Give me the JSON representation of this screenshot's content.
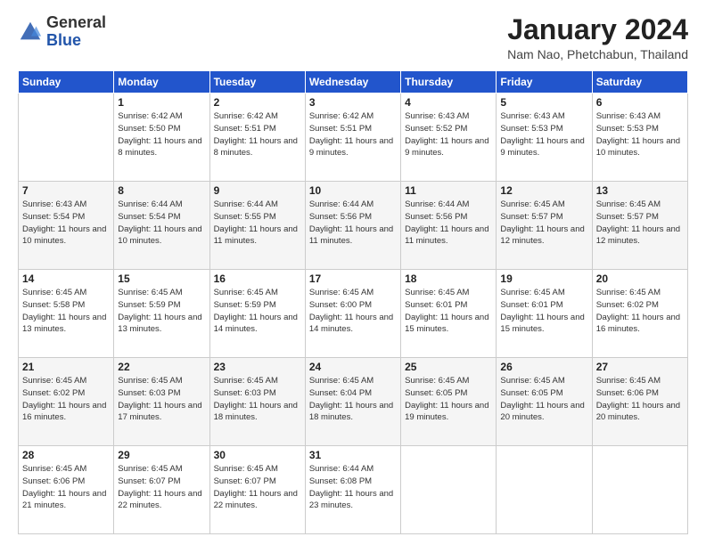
{
  "header": {
    "logo_general": "General",
    "logo_blue": "Blue",
    "title": "January 2024",
    "location": "Nam Nao, Phetchabun, Thailand"
  },
  "days_of_week": [
    "Sunday",
    "Monday",
    "Tuesday",
    "Wednesday",
    "Thursday",
    "Friday",
    "Saturday"
  ],
  "weeks": [
    [
      {
        "day": "",
        "sunrise": "",
        "sunset": "",
        "daylight": ""
      },
      {
        "day": "1",
        "sunrise": "Sunrise: 6:42 AM",
        "sunset": "Sunset: 5:50 PM",
        "daylight": "Daylight: 11 hours and 8 minutes."
      },
      {
        "day": "2",
        "sunrise": "Sunrise: 6:42 AM",
        "sunset": "Sunset: 5:51 PM",
        "daylight": "Daylight: 11 hours and 8 minutes."
      },
      {
        "day": "3",
        "sunrise": "Sunrise: 6:42 AM",
        "sunset": "Sunset: 5:51 PM",
        "daylight": "Daylight: 11 hours and 9 minutes."
      },
      {
        "day": "4",
        "sunrise": "Sunrise: 6:43 AM",
        "sunset": "Sunset: 5:52 PM",
        "daylight": "Daylight: 11 hours and 9 minutes."
      },
      {
        "day": "5",
        "sunrise": "Sunrise: 6:43 AM",
        "sunset": "Sunset: 5:53 PM",
        "daylight": "Daylight: 11 hours and 9 minutes."
      },
      {
        "day": "6",
        "sunrise": "Sunrise: 6:43 AM",
        "sunset": "Sunset: 5:53 PM",
        "daylight": "Daylight: 11 hours and 10 minutes."
      }
    ],
    [
      {
        "day": "7",
        "sunrise": "Sunrise: 6:43 AM",
        "sunset": "Sunset: 5:54 PM",
        "daylight": "Daylight: 11 hours and 10 minutes."
      },
      {
        "day": "8",
        "sunrise": "Sunrise: 6:44 AM",
        "sunset": "Sunset: 5:54 PM",
        "daylight": "Daylight: 11 hours and 10 minutes."
      },
      {
        "day": "9",
        "sunrise": "Sunrise: 6:44 AM",
        "sunset": "Sunset: 5:55 PM",
        "daylight": "Daylight: 11 hours and 11 minutes."
      },
      {
        "day": "10",
        "sunrise": "Sunrise: 6:44 AM",
        "sunset": "Sunset: 5:56 PM",
        "daylight": "Daylight: 11 hours and 11 minutes."
      },
      {
        "day": "11",
        "sunrise": "Sunrise: 6:44 AM",
        "sunset": "Sunset: 5:56 PM",
        "daylight": "Daylight: 11 hours and 11 minutes."
      },
      {
        "day": "12",
        "sunrise": "Sunrise: 6:45 AM",
        "sunset": "Sunset: 5:57 PM",
        "daylight": "Daylight: 11 hours and 12 minutes."
      },
      {
        "day": "13",
        "sunrise": "Sunrise: 6:45 AM",
        "sunset": "Sunset: 5:57 PM",
        "daylight": "Daylight: 11 hours and 12 minutes."
      }
    ],
    [
      {
        "day": "14",
        "sunrise": "Sunrise: 6:45 AM",
        "sunset": "Sunset: 5:58 PM",
        "daylight": "Daylight: 11 hours and 13 minutes."
      },
      {
        "day": "15",
        "sunrise": "Sunrise: 6:45 AM",
        "sunset": "Sunset: 5:59 PM",
        "daylight": "Daylight: 11 hours and 13 minutes."
      },
      {
        "day": "16",
        "sunrise": "Sunrise: 6:45 AM",
        "sunset": "Sunset: 5:59 PM",
        "daylight": "Daylight: 11 hours and 14 minutes."
      },
      {
        "day": "17",
        "sunrise": "Sunrise: 6:45 AM",
        "sunset": "Sunset: 6:00 PM",
        "daylight": "Daylight: 11 hours and 14 minutes."
      },
      {
        "day": "18",
        "sunrise": "Sunrise: 6:45 AM",
        "sunset": "Sunset: 6:01 PM",
        "daylight": "Daylight: 11 hours and 15 minutes."
      },
      {
        "day": "19",
        "sunrise": "Sunrise: 6:45 AM",
        "sunset": "Sunset: 6:01 PM",
        "daylight": "Daylight: 11 hours and 15 minutes."
      },
      {
        "day": "20",
        "sunrise": "Sunrise: 6:45 AM",
        "sunset": "Sunset: 6:02 PM",
        "daylight": "Daylight: 11 hours and 16 minutes."
      }
    ],
    [
      {
        "day": "21",
        "sunrise": "Sunrise: 6:45 AM",
        "sunset": "Sunset: 6:02 PM",
        "daylight": "Daylight: 11 hours and 16 minutes."
      },
      {
        "day": "22",
        "sunrise": "Sunrise: 6:45 AM",
        "sunset": "Sunset: 6:03 PM",
        "daylight": "Daylight: 11 hours and 17 minutes."
      },
      {
        "day": "23",
        "sunrise": "Sunrise: 6:45 AM",
        "sunset": "Sunset: 6:03 PM",
        "daylight": "Daylight: 11 hours and 18 minutes."
      },
      {
        "day": "24",
        "sunrise": "Sunrise: 6:45 AM",
        "sunset": "Sunset: 6:04 PM",
        "daylight": "Daylight: 11 hours and 18 minutes."
      },
      {
        "day": "25",
        "sunrise": "Sunrise: 6:45 AM",
        "sunset": "Sunset: 6:05 PM",
        "daylight": "Daylight: 11 hours and 19 minutes."
      },
      {
        "day": "26",
        "sunrise": "Sunrise: 6:45 AM",
        "sunset": "Sunset: 6:05 PM",
        "daylight": "Daylight: 11 hours and 20 minutes."
      },
      {
        "day": "27",
        "sunrise": "Sunrise: 6:45 AM",
        "sunset": "Sunset: 6:06 PM",
        "daylight": "Daylight: 11 hours and 20 minutes."
      }
    ],
    [
      {
        "day": "28",
        "sunrise": "Sunrise: 6:45 AM",
        "sunset": "Sunset: 6:06 PM",
        "daylight": "Daylight: 11 hours and 21 minutes."
      },
      {
        "day": "29",
        "sunrise": "Sunrise: 6:45 AM",
        "sunset": "Sunset: 6:07 PM",
        "daylight": "Daylight: 11 hours and 22 minutes."
      },
      {
        "day": "30",
        "sunrise": "Sunrise: 6:45 AM",
        "sunset": "Sunset: 6:07 PM",
        "daylight": "Daylight: 11 hours and 22 minutes."
      },
      {
        "day": "31",
        "sunrise": "Sunrise: 6:44 AM",
        "sunset": "Sunset: 6:08 PM",
        "daylight": "Daylight: 11 hours and 23 minutes."
      },
      {
        "day": "",
        "sunrise": "",
        "sunset": "",
        "daylight": ""
      },
      {
        "day": "",
        "sunrise": "",
        "sunset": "",
        "daylight": ""
      },
      {
        "day": "",
        "sunrise": "",
        "sunset": "",
        "daylight": ""
      }
    ]
  ]
}
